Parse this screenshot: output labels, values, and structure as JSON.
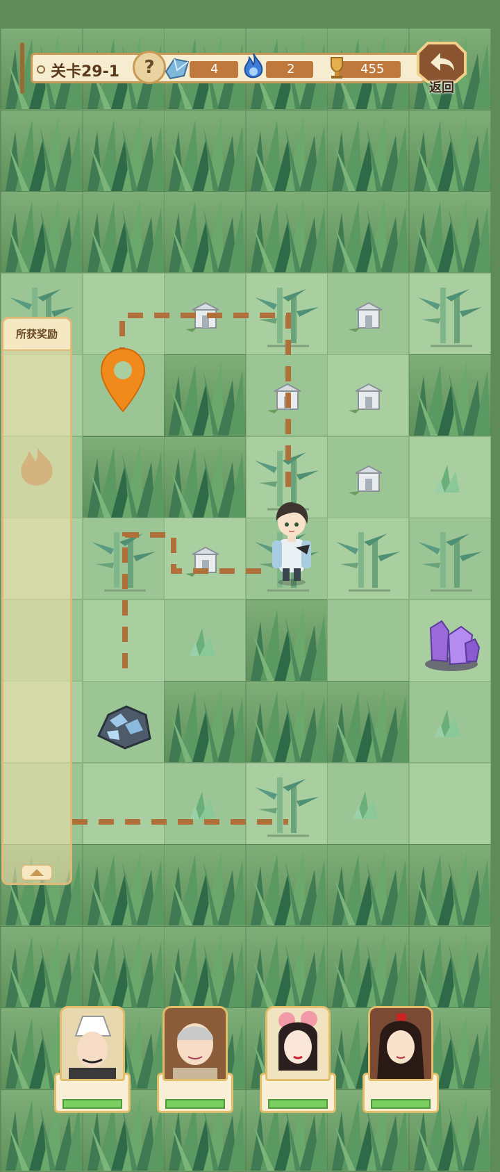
{
  "hud": {
    "level_label": "关卡29-1",
    "help_symbol": "?",
    "crystal_count": "4",
    "flame_count": "2",
    "trophy_count": "455",
    "back_label": "返回"
  },
  "reward_panel": {
    "title": "所获奖励"
  },
  "colors": {
    "dense_grass": "#6a9c64",
    "open_tile": "#a9cfa1",
    "path_dash": "#b0703a",
    "marker": "#f08a1c",
    "hud_pill": "#c0793c"
  },
  "map": {
    "rows": [
      [
        "dense",
        "dense",
        "dense",
        "dense",
        "dense",
        "dense"
      ],
      [
        "dense",
        "dense",
        "dense",
        "dense",
        "dense",
        "dense"
      ],
      [
        "dense",
        "dense",
        "dense",
        "dense",
        "dense",
        "dense"
      ],
      [
        "bamboo",
        "open",
        "stone-lantern",
        "bamboo",
        "stone-lantern",
        "bamboo"
      ],
      [
        "open",
        "marker",
        "dense",
        "stone-lantern",
        "stone-lantern",
        "dense"
      ],
      [
        "open",
        "dense",
        "dense",
        "bamboo",
        "stone-lantern",
        "grass-tuft"
      ],
      [
        "open",
        "bamboo",
        "stone-lantern",
        "player",
        "bamboo",
        "bamboo"
      ],
      [
        "open",
        "open",
        "grass-tuft",
        "dense",
        "open",
        "purple-crystal"
      ],
      [
        "open",
        "blue-ore",
        "dense",
        "dense",
        "dense",
        "grass-tuft"
      ],
      [
        "open",
        "open",
        "grass-tuft",
        "bamboo",
        "grass-tuft",
        "open"
      ],
      [
        "dense",
        "dense",
        "dense",
        "dense",
        "dense",
        "dense"
      ],
      [
        "dense",
        "dense",
        "dense",
        "dense",
        "dense",
        "dense"
      ],
      [
        "dense",
        "dense",
        "dense",
        "dense",
        "dense",
        "dense"
      ],
      [
        "dense",
        "dense",
        "dense",
        "dense",
        "dense",
        "dense"
      ]
    ]
  },
  "heroes": [
    {
      "name": "hero-scholar-white-hat"
    },
    {
      "name": "hero-monk"
    },
    {
      "name": "hero-lady-flowers"
    },
    {
      "name": "hero-swordswoman"
    }
  ]
}
